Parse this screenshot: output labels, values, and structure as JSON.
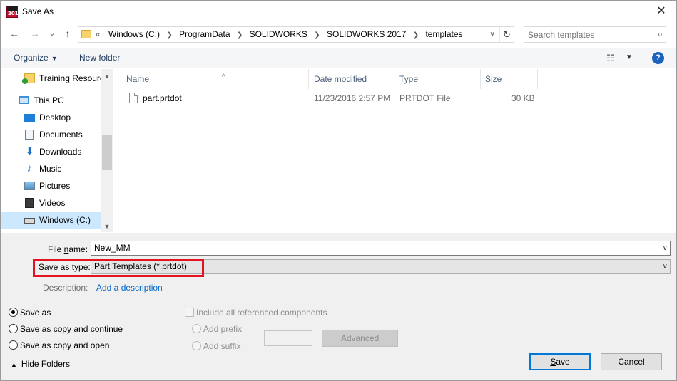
{
  "window": {
    "title": "Save As",
    "app_icon_text": "2017",
    "close_glyph": "✕"
  },
  "nav": {
    "back_glyph": "←",
    "forward_glyph": "→",
    "recent_glyph": "⌄",
    "up_glyph": "↑",
    "breadcrumb_prefix": "«",
    "breadcrumb": [
      "Windows (C:)",
      "ProgramData",
      "SOLIDWORKS",
      "SOLIDWORKS 2017",
      "templates"
    ],
    "refresh_glyph": "↻",
    "search_placeholder": "Search templates"
  },
  "toolbar": {
    "organize_label": "Organize",
    "new_folder_label": "New folder",
    "help_glyph": "?"
  },
  "sidebar": {
    "items": [
      {
        "label": "Training Resourc",
        "icon": "folder-check-icon"
      },
      {
        "label": "This PC",
        "icon": "computer-icon"
      },
      {
        "label": "Desktop",
        "icon": "desktop-icon"
      },
      {
        "label": "Documents",
        "icon": "documents-icon"
      },
      {
        "label": "Downloads",
        "icon": "downloads-icon"
      },
      {
        "label": "Music",
        "icon": "music-icon"
      },
      {
        "label": "Pictures",
        "icon": "pictures-icon"
      },
      {
        "label": "Videos",
        "icon": "videos-icon"
      },
      {
        "label": "Windows (C:)",
        "icon": "drive-icon"
      }
    ],
    "selected_index": 8
  },
  "file_list": {
    "columns": [
      "Name",
      "Date modified",
      "Type",
      "Size"
    ],
    "sort_glyph": "^",
    "rows": [
      {
        "name": "part.prtdot",
        "date": "11/23/2016 2:57 PM",
        "type": "PRTDOT File",
        "size": "30 KB"
      }
    ]
  },
  "form": {
    "file_name_label_pre": "File ",
    "file_name_label_u": "n",
    "file_name_label_post": "ame:",
    "file_name_value": "New_MM",
    "save_type_label_pre": "Save as ",
    "save_type_label_u": "t",
    "save_type_label_post": "ype:",
    "save_type_value": "Part Templates (*.prtdot)",
    "description_label": "Description:",
    "description_link": "Add a description"
  },
  "options": {
    "save_as": "Save as",
    "save_as_copy_continue": "Save as copy and continue",
    "save_as_copy_open": "Save as copy and open",
    "selected": "save_as",
    "include_refs": "Include all referenced components",
    "add_prefix": "Add prefix",
    "add_suffix": "Add suffix",
    "advanced_button": "Advanced"
  },
  "footer": {
    "hide_folders": "Hide Folders",
    "save_button_u": "S",
    "save_button_rest": "ave",
    "cancel_button": "Cancel"
  },
  "colors": {
    "accent": "#0078d7",
    "highlight_box": "#e1141f",
    "link": "#0066cc",
    "selected_bg": "#cce8ff"
  }
}
